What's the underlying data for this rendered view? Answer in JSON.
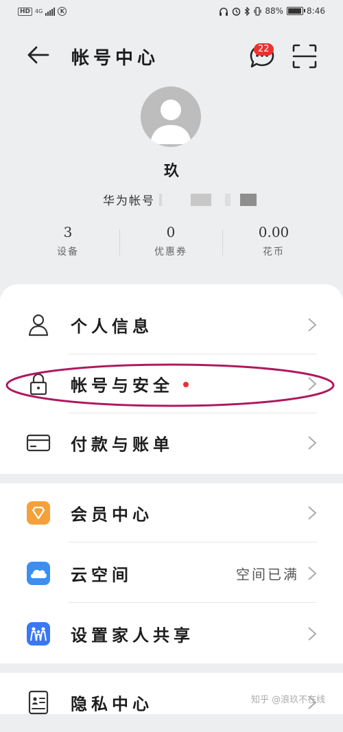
{
  "status_bar": {
    "hd": "HD",
    "network": "4G",
    "battery": "88%",
    "time": "8:46",
    "battery_level": 0.88
  },
  "header": {
    "title": "帐号中心",
    "notification_count": "22"
  },
  "profile": {
    "nickname": "玖",
    "account_label": "华为帐号"
  },
  "stats": [
    {
      "value": "3",
      "label": "设备"
    },
    {
      "value": "0",
      "label": "优惠券"
    },
    {
      "value": "0.00",
      "label": "花币"
    }
  ],
  "menu": {
    "personal_info": {
      "label": "个人信息",
      "icon": "person-icon"
    },
    "account_security": {
      "label": "帐号与安全",
      "icon": "lock-icon"
    },
    "payment": {
      "label": "付款与账单",
      "icon": "card-icon"
    },
    "membership": {
      "label": "会员中心",
      "icon": "diamond-icon"
    },
    "cloud": {
      "label": "云空间",
      "value": "空间已满",
      "icon": "cloud-icon"
    },
    "family_share": {
      "label": "设置家人共享",
      "icon": "family-icon"
    },
    "privacy": {
      "label": "隐私中心",
      "icon": "id-card-icon"
    }
  },
  "watermark": "知乎 @浪玖不在线",
  "colors": {
    "background": "#eceef0",
    "badge": "#e8332f",
    "highlight": "#b0185e",
    "member_orange": "#f5a13a",
    "cloud_blue": "#3c8ef2",
    "family_blue": "#3a78f2"
  }
}
